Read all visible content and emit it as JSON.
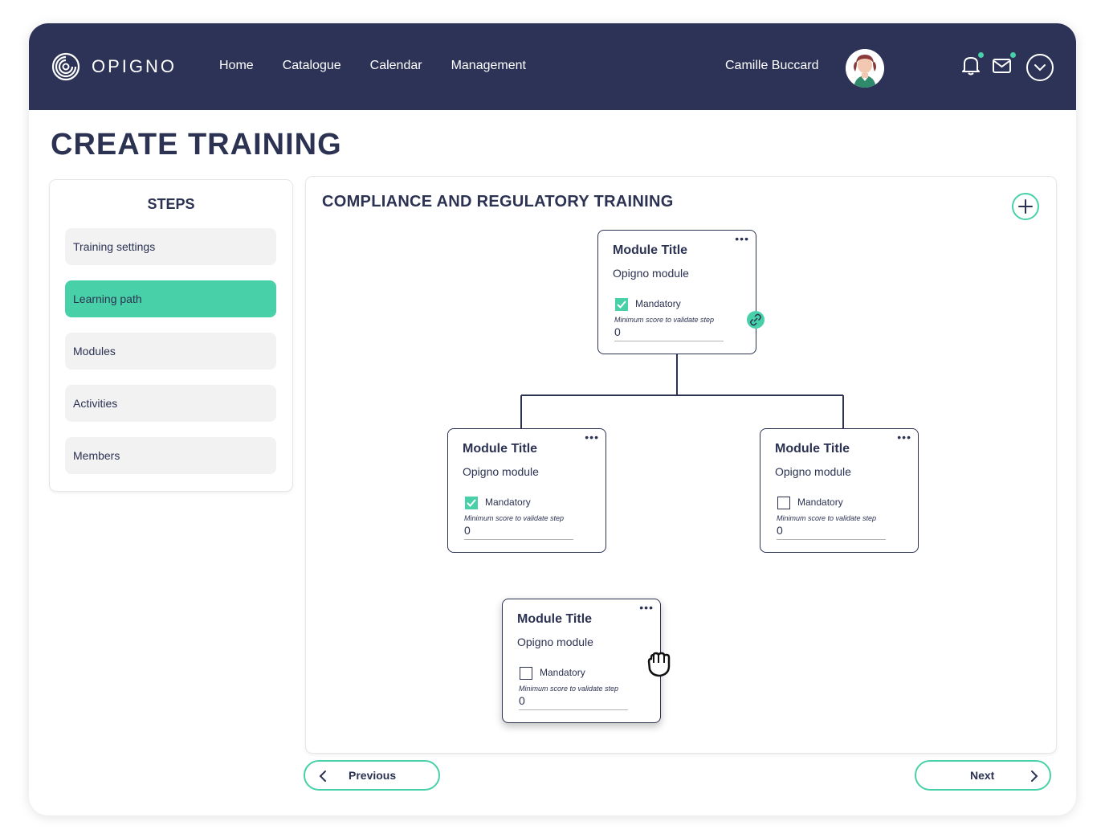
{
  "header": {
    "logo_text": "OPIGNO",
    "nav": [
      "Home",
      "Catalogue",
      "Calendar",
      "Management"
    ],
    "user_name": "Camille Buccard"
  },
  "page_title": "CREATE TRAINING",
  "steps": {
    "title": "STEPS",
    "items": [
      {
        "label": "Training settings",
        "active": false
      },
      {
        "label": "Learning path",
        "active": true
      },
      {
        "label": "Modules",
        "active": false
      },
      {
        "label": "Activities",
        "active": false
      },
      {
        "label": "Members",
        "active": false
      }
    ]
  },
  "canvas": {
    "title": "COMPLIANCE AND REGULATORY TRAINING",
    "modules": [
      {
        "title": "Module Title",
        "subtitle": "Opigno module",
        "mandatory_label": "Mandatory",
        "mandatory": true,
        "score_label": "Minimum score to validate step",
        "score": "0"
      },
      {
        "title": "Module Title",
        "subtitle": "Opigno module",
        "mandatory_label": "Mandatory",
        "mandatory": true,
        "score_label": "Minimum score to validate step",
        "score": "0"
      },
      {
        "title": "Module Title",
        "subtitle": "Opigno module",
        "mandatory_label": "Mandatory",
        "mandatory": false,
        "score_label": "Minimum score to validate step",
        "score": "0"
      },
      {
        "title": "Module Title",
        "subtitle": "Opigno module",
        "mandatory_label": "Mandatory",
        "mandatory": false,
        "score_label": "Minimum score to validate step",
        "score": "0"
      }
    ]
  },
  "footer": {
    "previous_label": "Previous",
    "next_label": "Next"
  },
  "colors": {
    "navy": "#2c3356",
    "accent": "#48d1a8"
  },
  "icons": [
    "logo-icon",
    "bell-icon",
    "mail-icon",
    "chevron-down-icon",
    "plus-icon",
    "more-icon",
    "link-icon",
    "grab-hand-icon",
    "chevron-left-icon",
    "chevron-right-icon"
  ]
}
